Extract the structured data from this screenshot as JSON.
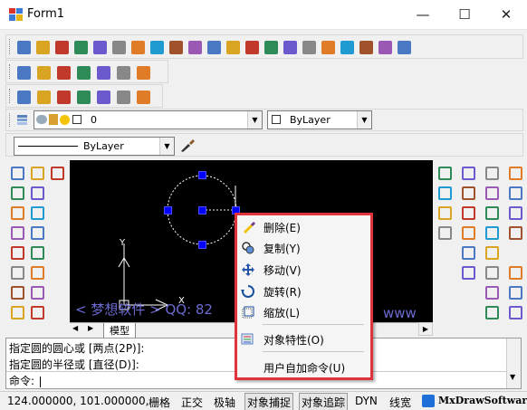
{
  "window": {
    "title": "Form1",
    "minimize": "—",
    "maximize": "☐",
    "close": "✕"
  },
  "colors": {
    "canvas": "#000000",
    "grip": "#0000ff",
    "highlight": "#e0343c",
    "menu_bg": "#f5f5f5"
  },
  "toolbar": {
    "main_icons": [
      "new-icon",
      "open-icon",
      "open-folder-icon",
      "tools-icon",
      "save-icon",
      "save-as-icon",
      "zoom-window-icon",
      "zoom-realtime-icon",
      "pan-icon",
      "distance-icon",
      "measure-angle-icon",
      "lightbulb-icon",
      "hammer-icon",
      "zoom-in-icon",
      "zoom-out-icon",
      "move-icon",
      "pen-icon",
      "palette-icon",
      "layers-icon",
      "brush-icon",
      "eraser-icon"
    ],
    "edit_icons": [
      "undo-icon",
      "redo-icon",
      "print-icon",
      "render-icon",
      "globe-icon",
      "pdf-icon",
      "image-icon"
    ],
    "misc_icons": [
      "card-icon",
      "rectangle-icon",
      "cloud-icon",
      "speech-icon",
      "target-icon",
      "pencil-icon",
      "search-icon"
    ]
  },
  "layer": {
    "value": "0",
    "color_value": "ByLayer",
    "linetype_value": "ByLayer"
  },
  "context_menu": {
    "items": [
      {
        "label": "删除(E)",
        "icon": "eraser-icon"
      },
      {
        "label": "复制(Y)",
        "icon": "copy-icon"
      },
      {
        "label": "移动(V)",
        "icon": "move-icon"
      },
      {
        "label": "旋转(R)",
        "icon": "rotate-icon"
      },
      {
        "label": "缩放(L)",
        "icon": "scale-icon"
      },
      {
        "label": "对象特性(O)",
        "icon": "properties-icon"
      },
      {
        "label": "用户自加命令(U)",
        "icon": ""
      }
    ]
  },
  "tabs": {
    "model": "模型"
  },
  "canvas": {
    "watermark": "< 梦想软件 >   QQ: 82",
    "watermark2": "www",
    "ucs_y": "Y",
    "ucs_x": "X"
  },
  "command": {
    "lines": [
      "指定圆的圆心或 [两点(2P)]:",
      "指定圆的半径或 [直径(D)]:"
    ],
    "prompt": "命令:"
  },
  "status": {
    "coords": "124.000000, 101.000000,",
    "grid": "栅格",
    "ortho": "正交",
    "polar": "极轴",
    "osnap": "对象捕捉",
    "otrack": "对象追踪",
    "dyn": "DYN",
    "lwt": "线宽",
    "brand": "MxDrawSoftware"
  }
}
